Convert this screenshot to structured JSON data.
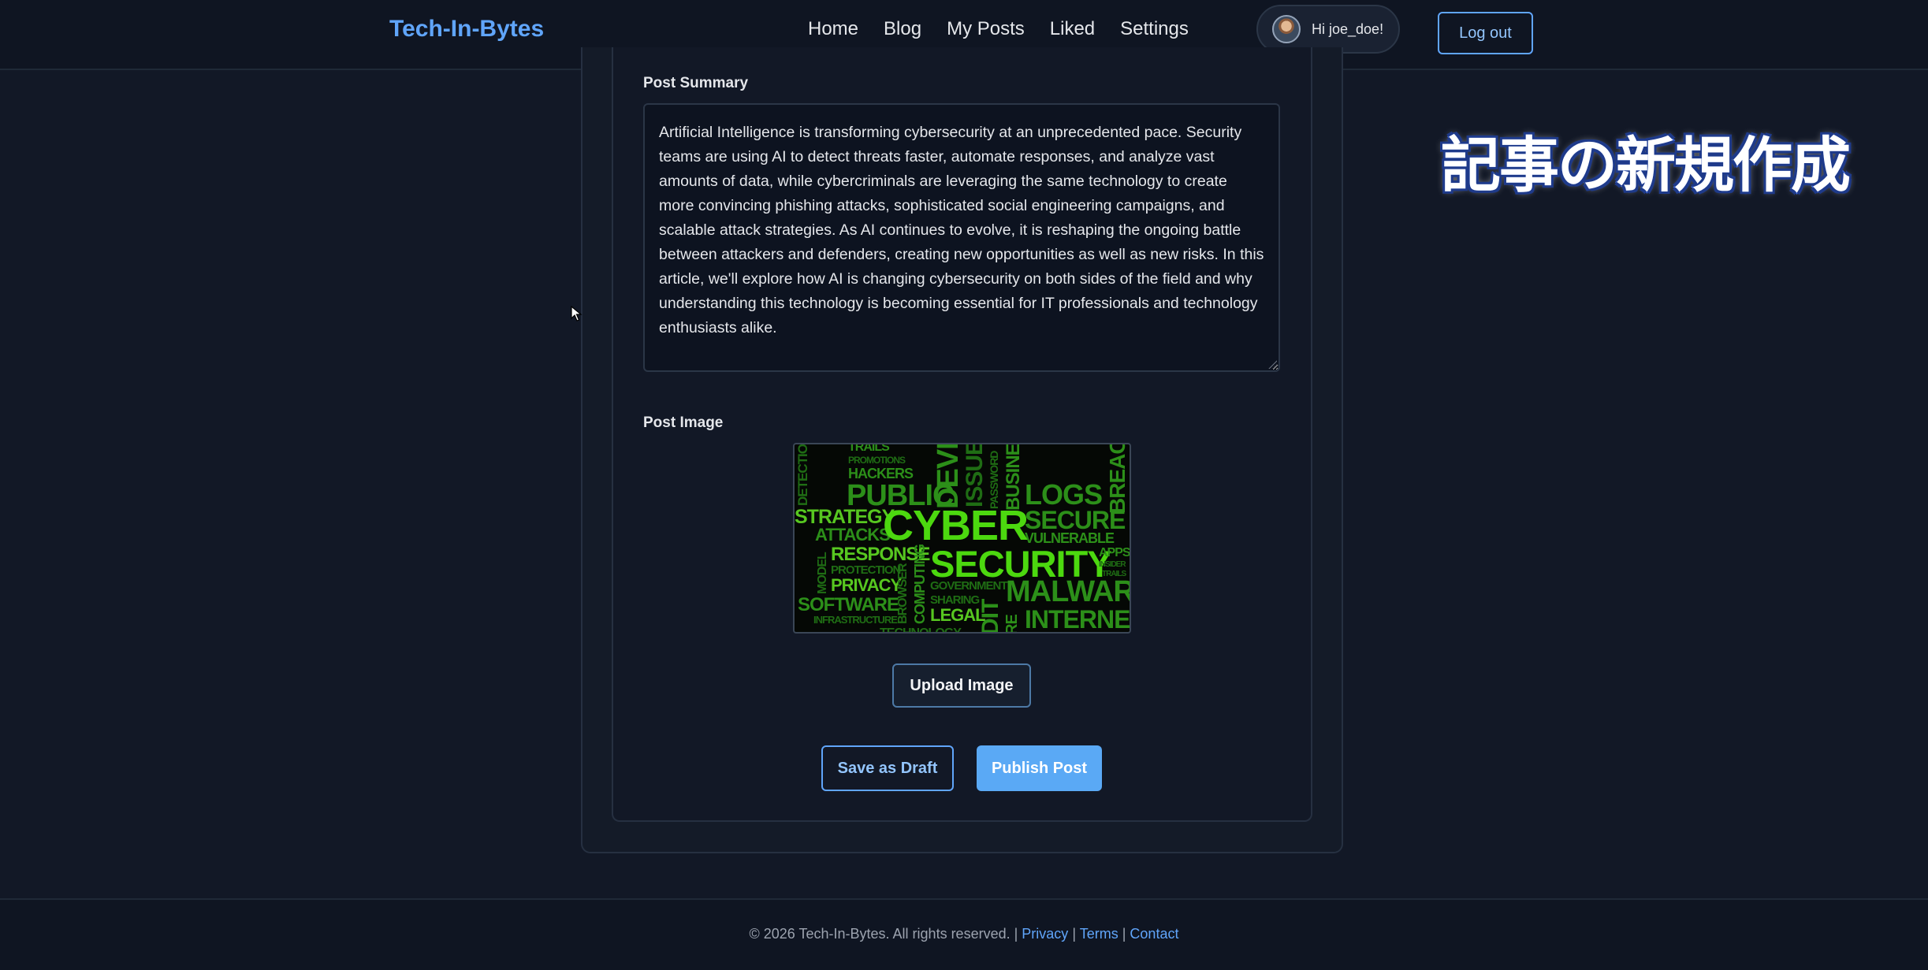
{
  "header": {
    "brand": "Tech-In-Bytes",
    "nav": [
      "Home",
      "Blog",
      "My Posts",
      "Liked",
      "Settings"
    ],
    "greeting": "Hi joe_doe!",
    "logout_label": "Log out"
  },
  "form": {
    "summary_label": "Post Summary",
    "summary_text": "Artificial Intelligence is transforming cybersecurity at an unprecedented pace. Security teams are using AI to detect threats faster, automate responses, and analyze vast amounts of data, while cybercriminals are leveraging the same technology to create more convincing phishing attacks, sophisticated social engineering campaigns, and scalable attack strategies. As AI continues to evolve, it is reshaping the ongoing battle between attackers and defenders, creating new opportunities as well as new risks. In this article, we'll explore how AI is changing cybersecurity on both sides of the field and why understanding this technology is becoming essential for IT professionals and technology enthusiasts alike.",
    "image_label": "Post Image",
    "upload_label": "Upload Image",
    "draft_label": "Save as Draft",
    "publish_label": "Publish Post"
  },
  "post_image": {
    "words": [
      "TRAILS",
      "PROMOTIONS",
      "HACKERS",
      "DETECTION",
      "PUBLIC",
      "DEVI",
      "ISSUES",
      "PASSWORD",
      "BUSINESS",
      "LOGS",
      "BREAC",
      "STRATEGY",
      "ATTACKS",
      "CYBER",
      "SECURE",
      "VULNERABLE",
      "MODEL",
      "RESPONSE",
      "PROTECTION",
      "PRIVACY",
      "BROWSER",
      "COMPUTING",
      "SECURITY",
      "APPS",
      "INSIDER",
      "TRAILS",
      "GOVERNMENT",
      "SHARING",
      "MALWARE",
      "SOFTWARE",
      "INFRASTRUCTURE",
      "LEGAL",
      "DIT",
      "RE",
      "INTERNET",
      "TECHNOLOGY"
    ]
  },
  "overlay": {
    "caption": "記事の新規作成"
  },
  "footer": {
    "copyright": "© 2026 Tech-In-Bytes. All rights reserved. |",
    "links": [
      "Privacy",
      "Terms",
      "Contact"
    ],
    "separator": "|"
  },
  "colors": {
    "background": "#121826",
    "accent": "#60a5fa",
    "publish": "#5aa9f5"
  }
}
